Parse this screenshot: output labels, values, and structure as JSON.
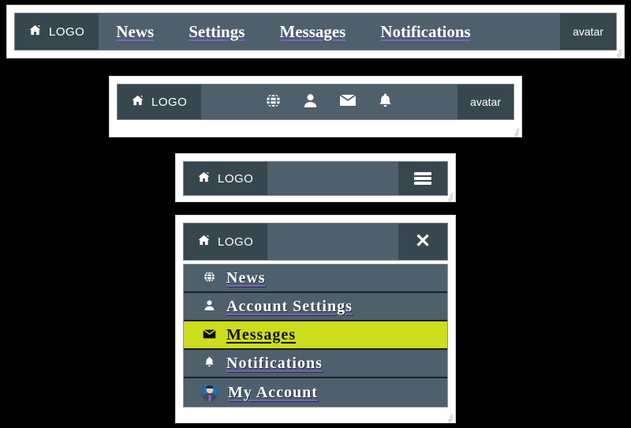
{
  "brand": {
    "home_icon": "home-icon",
    "label": "LOGO"
  },
  "window1": {
    "nav_links": [
      {
        "label": "News"
      },
      {
        "label": "Settings"
      },
      {
        "label": "Messages"
      },
      {
        "label": "Notifications"
      }
    ],
    "avatar_label": "avatar"
  },
  "window2": {
    "icons": [
      {
        "name": "globe-icon",
        "glyph": "⊕"
      },
      {
        "name": "user-icon",
        "glyph": "\u0000"
      },
      {
        "name": "envelope-icon",
        "glyph": "✉"
      },
      {
        "name": "bell-icon",
        "glyph": "\u0000"
      }
    ],
    "avatar_label": "avatar"
  },
  "window3": {
    "toggle_name": "hamburger-menu-button"
  },
  "window4": {
    "close_label": "✕",
    "menu_items": [
      {
        "icon": "globe-icon",
        "label": "News",
        "active": false
      },
      {
        "icon": "user-icon",
        "label": "Account Settings",
        "active": false
      },
      {
        "icon": "envelope-icon",
        "label": "Messages",
        "active": true
      },
      {
        "icon": "bell-icon",
        "label": "Notifications",
        "active": false
      },
      {
        "icon": "avatar-icon",
        "label": "My Account",
        "active": false
      }
    ]
  },
  "colors": {
    "page_background": "#000000",
    "window_background": "#ffffff",
    "navbar": "#4e606b",
    "brand_panel": "#37474f",
    "text": "#ffffff",
    "link_underline": "#7a60c8",
    "active_highlight": "#cddc1c",
    "menu_divider": "#1b2124"
  }
}
